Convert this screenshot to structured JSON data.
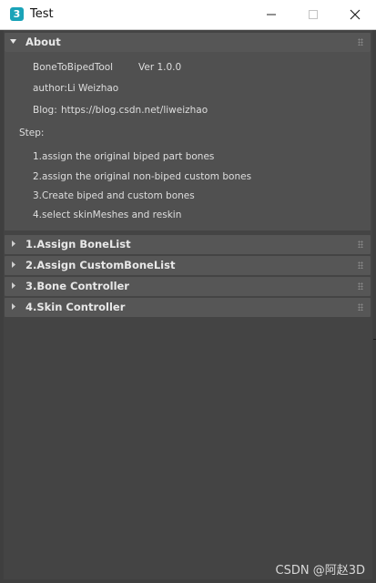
{
  "window": {
    "app_icon_glyph": "3",
    "title": "Test",
    "buttons": {
      "minimize": "minimize-icon",
      "maximize": "maximize-icon",
      "close": "close-icon"
    }
  },
  "about": {
    "title": "About",
    "tool_name": "BoneToBipedTool",
    "version": "Ver 1.0.0",
    "author": "author:Li Weizhao",
    "blog_label": "Blog:",
    "blog_url": "https://blog.csdn.net/liweizhao",
    "step_label": "Step:",
    "steps": [
      "1.assign the original biped part bones",
      "2.assign the original non-biped custom bones",
      "3.Create biped and custom bones",
      "4.select skinMeshes and reskin"
    ]
  },
  "rollouts": [
    {
      "title": "1.Assign BoneList"
    },
    {
      "title": "2.Assign CustomBoneList"
    },
    {
      "title": "3.Bone Controller"
    },
    {
      "title": "4.Skin Controller"
    }
  ],
  "watermark": "CSDN @阿赵3D",
  "colors": {
    "background": "#3f3f3f",
    "panel": "#444444",
    "rollout_header": "#565656",
    "app_icon": "#1aa3b8"
  }
}
